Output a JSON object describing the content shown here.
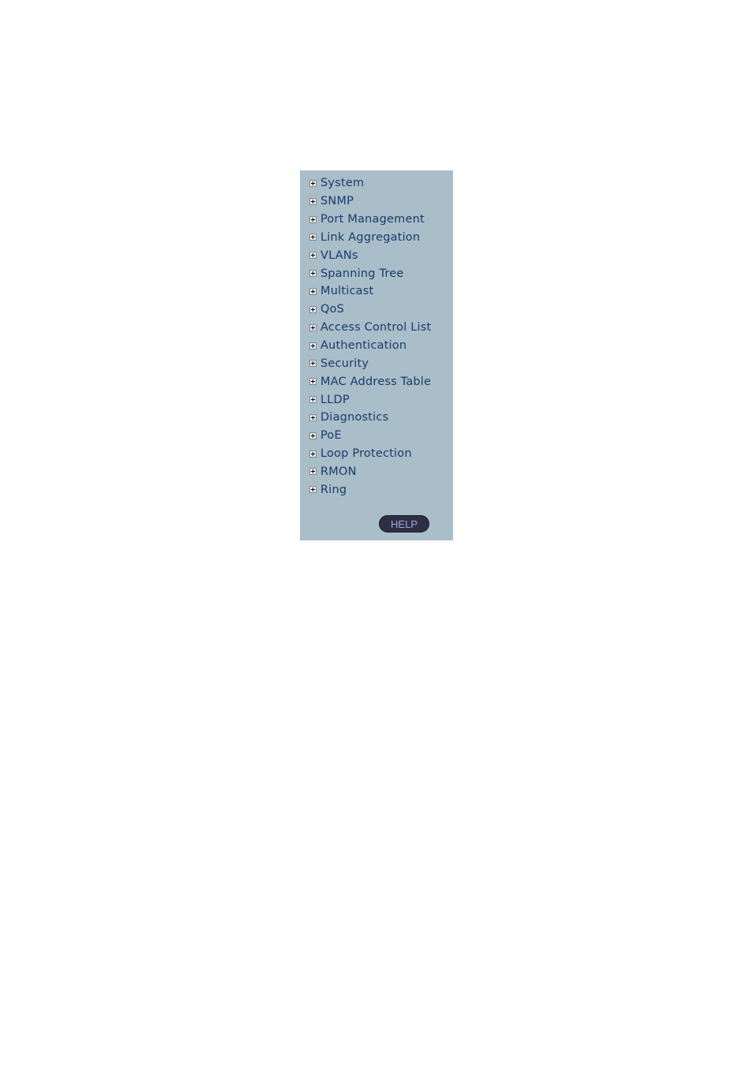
{
  "menu": {
    "items": [
      {
        "label": "System",
        "icon": "expand-plus-icon"
      },
      {
        "label": "SNMP",
        "icon": "expand-plus-icon"
      },
      {
        "label": "Port Management",
        "icon": "expand-plus-icon"
      },
      {
        "label": "Link Aggregation",
        "icon": "expand-plus-icon"
      },
      {
        "label": "VLANs",
        "icon": "expand-plus-icon"
      },
      {
        "label": "Spanning Tree",
        "icon": "expand-plus-icon"
      },
      {
        "label": "Multicast",
        "icon": "expand-plus-icon"
      },
      {
        "label": "QoS",
        "icon": "expand-plus-icon"
      },
      {
        "label": "Access Control List",
        "icon": "expand-plus-icon"
      },
      {
        "label": "Authentication",
        "icon": "expand-plus-icon"
      },
      {
        "label": "Security",
        "icon": "expand-plus-icon"
      },
      {
        "label": "MAC Address Table",
        "icon": "expand-plus-icon"
      },
      {
        "label": "LLDP",
        "icon": "expand-plus-icon"
      },
      {
        "label": "Diagnostics",
        "icon": "expand-plus-icon"
      },
      {
        "label": "PoE",
        "icon": "expand-plus-icon"
      },
      {
        "label": "Loop Protection",
        "icon": "expand-plus-icon"
      },
      {
        "label": "RMON",
        "icon": "expand-plus-icon"
      },
      {
        "label": "Ring",
        "icon": "expand-plus-icon"
      }
    ],
    "help_label": "HELP"
  },
  "colors": {
    "panel_bg": "#a9bec8",
    "link_text": "#1b3a6b",
    "help_bg": "#2e2f44",
    "help_text": "#9ea6d8"
  }
}
